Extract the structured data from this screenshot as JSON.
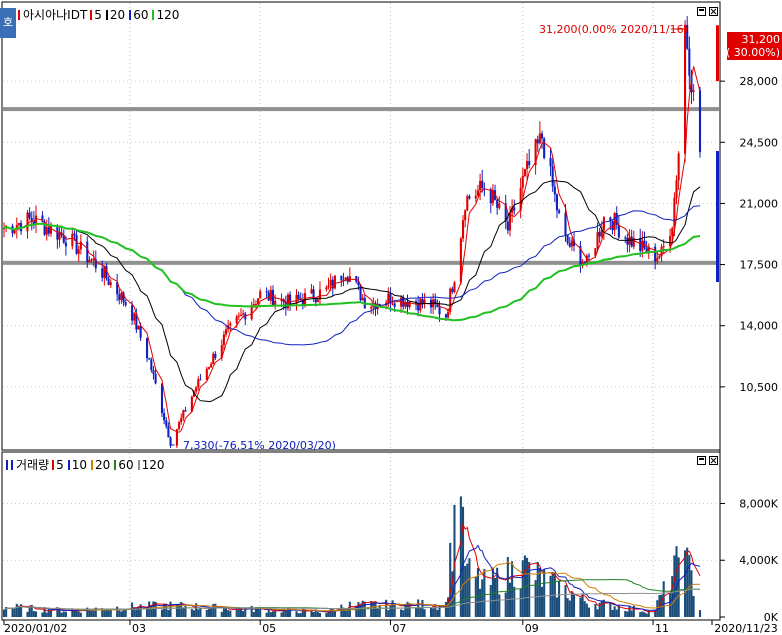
{
  "app": {
    "side_tab_label": "호"
  },
  "price_legend": {
    "title": "아시아나IDT",
    "items": [
      {
        "label": "5",
        "color": "#e00000"
      },
      {
        "label": "20",
        "color": "#000000"
      },
      {
        "label": "60",
        "color": "#1020c0"
      },
      {
        "label": "120",
        "color": "#20c020"
      }
    ]
  },
  "volume_legend": {
    "title": "거래량",
    "items": [
      {
        "label": "5",
        "color": "#e00000"
      },
      {
        "label": "10",
        "color": "#1020c0"
      },
      {
        "label": "20",
        "color": "#d08000"
      },
      {
        "label": "60",
        "color": "#208020"
      },
      {
        "label": "120",
        "color": "#909090"
      }
    ]
  },
  "chart_data": [
    {
      "type": "candlestick",
      "title": "아시아나IDT",
      "y_ticks": [
        "28,000",
        "24,500",
        "21,000",
        "17,500",
        "14,000",
        "10,500"
      ],
      "y_tick_values": [
        28000,
        24500,
        21000,
        17500,
        14000,
        10500
      ],
      "ylim": [
        7000,
        31500
      ],
      "x_tick_labels": [
        "2020/01/02",
        "03",
        "05",
        "07",
        "09",
        "11",
        "2020/11/23"
      ],
      "x_range": [
        "2020/01/02",
        "2020/11/23"
      ],
      "horizontal_lines": [
        26400,
        17600
      ],
      "annotations": {
        "high": {
          "text": "31,200(0.00% 2020/11/16)",
          "value": 31200,
          "date": "2020/11/16"
        },
        "low": {
          "text": "7,330(-76.51% 2020/03/20)",
          "value": 7330,
          "date": "2020/03/20"
        },
        "last_price": {
          "price": "31,200",
          "change": "( 30.00%)",
          "value": 31200
        }
      },
      "moving_averages": [
        {
          "name": "5",
          "color": "#e00000"
        },
        {
          "name": "20",
          "color": "#000000"
        },
        {
          "name": "60",
          "color": "#1020c0"
        },
        {
          "name": "120",
          "color": "#20c020"
        }
      ],
      "keypoints_close": [
        [
          "2020/01/02",
          19600
        ],
        [
          "2020/01/15",
          20100
        ],
        [
          "2020/02/01",
          19000
        ],
        [
          "2020/02/15",
          17400
        ],
        [
          "2020/03/01",
          15000
        ],
        [
          "2020/03/10",
          12000
        ],
        [
          "2020/03/20",
          7330
        ],
        [
          "2020/04/01",
          10500
        ],
        [
          "2020/04/15",
          13500
        ],
        [
          "2020/05/01",
          15800
        ],
        [
          "2020/05/15",
          15300
        ],
        [
          "2020/06/01",
          16000
        ],
        [
          "2020/06/10",
          17200
        ],
        [
          "2020/06/20",
          15200
        ],
        [
          "2020/07/01",
          15600
        ],
        [
          "2020/07/20",
          15200
        ],
        [
          "2020/07/27",
          14600
        ],
        [
          "2020/08/01",
          17500
        ],
        [
          "2020/08/05",
          21200
        ],
        [
          "2020/08/15",
          22000
        ],
        [
          "2020/08/25",
          19500
        ],
        [
          "2020/09/01",
          22300
        ],
        [
          "2020/09/10",
          24800
        ],
        [
          "2020/09/20",
          19000
        ],
        [
          "2020/10/01",
          17500
        ],
        [
          "2020/10/10",
          20500
        ],
        [
          "2020/10/20",
          19000
        ],
        [
          "2020/11/01",
          18000
        ],
        [
          "2020/11/05",
          18100
        ],
        [
          "2020/11/10",
          20000
        ],
        [
          "2020/11/13",
          24000
        ],
        [
          "2020/11/16",
          31200
        ],
        [
          "2020/11/23",
          24000
        ]
      ]
    },
    {
      "type": "bar",
      "title": "거래량",
      "y_ticks": [
        "8,000K",
        "4,000K",
        "0K"
      ],
      "y_tick_values": [
        8000,
        4000,
        0
      ],
      "ylim": [
        0,
        10500
      ],
      "unit": "K",
      "x_tick_labels": [
        "2020/01/02",
        "03",
        "05",
        "07",
        "09",
        "11",
        "2020/11/23"
      ],
      "keypoints_volume": [
        [
          "2020/01/02",
          800
        ],
        [
          "2020/02/01",
          500
        ],
        [
          "2020/03/01",
          800
        ],
        [
          "2020/03/20",
          900
        ],
        [
          "2020/04/15",
          700
        ],
        [
          "2020/06/01",
          400
        ],
        [
          "2020/06/10",
          900
        ],
        [
          "2020/07/27",
          1000
        ],
        [
          "2020/08/01",
          9300
        ],
        [
          "2020/08/03",
          8500
        ],
        [
          "2020/08/05",
          3600
        ],
        [
          "2020/08/15",
          2500
        ],
        [
          "2020/09/01",
          4000
        ],
        [
          "2020/09/10",
          3000
        ],
        [
          "2020/10/01",
          1200
        ],
        [
          "2020/11/01",
          400
        ],
        [
          "2020/11/13",
          4200
        ],
        [
          "2020/11/16",
          4700
        ],
        [
          "2020/11/23",
          700
        ]
      ]
    }
  ]
}
